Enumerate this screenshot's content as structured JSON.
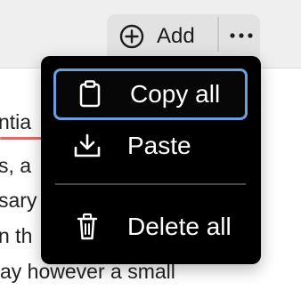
{
  "toolbar": {
    "add_label": "Add",
    "add_icon": "plus-circle-icon",
    "more_icon": "more-horizontal-icon"
  },
  "menu": {
    "items": [
      {
        "label": "Copy all",
        "icon": "clipboard-icon",
        "selected": true
      },
      {
        "label": "Paste",
        "icon": "download-icon",
        "selected": false
      },
      {
        "label": "Delete all",
        "icon": "trash-icon",
        "selected": false
      }
    ]
  },
  "editor": {
    "lines": [
      "ntia",
      "s, a",
      "sary",
      "n th",
      "ay however a small"
    ]
  },
  "colors": {
    "menu_background": "#000000",
    "selection_border": "#6b9fe0",
    "spelling_underline": "#e06a6a"
  }
}
